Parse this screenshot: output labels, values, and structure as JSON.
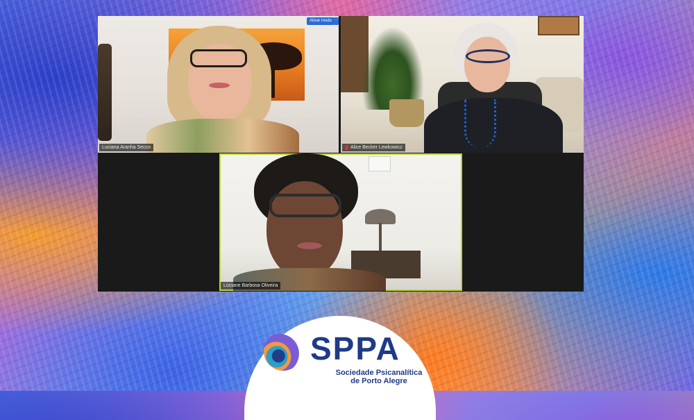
{
  "participants": [
    {
      "name": "Luciana Aranha Secco",
      "tile": 1
    },
    {
      "name": "Alice Becker Lewkowicz",
      "tile": 2,
      "muted": true
    },
    {
      "name": "Lúciane Barbosa Oliveira",
      "tile": 3,
      "active_speaker": true
    }
  ],
  "controls": {
    "unmute_label": "Ativar mudo",
    "more_label": "···"
  },
  "logo": {
    "title": "SPPA",
    "subtitle_line1": "Sociedade Psicanalítica",
    "subtitle_line2": "de Porto Alegre"
  },
  "colors": {
    "active_speaker_border": "#b9d83a",
    "logo_blue": "#1f3a86",
    "muted_icon": "#e0302a"
  }
}
